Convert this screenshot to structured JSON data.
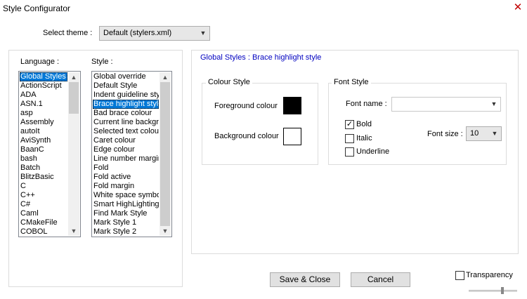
{
  "window": {
    "title": "Style Configurator",
    "close_glyph": "✕"
  },
  "theme": {
    "label": "Select theme :",
    "value": "Default (stylers.xml)"
  },
  "language": {
    "label": "Language :",
    "items": [
      "Global Styles",
      "ActionScript",
      "ADA",
      "ASN.1",
      "asp",
      "Assembly",
      "autoIt",
      "AviSynth",
      "BaanC",
      "bash",
      "Batch",
      "BlitzBasic",
      "C",
      "C++",
      "C#",
      "Caml",
      "CMakeFile",
      "COBOL"
    ],
    "selected_index": 0
  },
  "style": {
    "label": "Style :",
    "items": [
      "Global override",
      "Default Style",
      "Indent guideline style",
      "Brace highlight style",
      "Bad brace colour",
      "Current line background colour",
      "Selected text colour",
      "Caret colour",
      "Edge colour",
      "Line number margin",
      "Fold",
      "Fold active",
      "Fold margin",
      "White space symbol",
      "Smart HighLighting",
      "Find Mark Style",
      "Mark Style 1",
      "Mark Style 2"
    ],
    "selected_index": 3
  },
  "detail": {
    "heading": "Global Styles : Brace highlight style"
  },
  "colour_style": {
    "title": "Colour Style",
    "foreground_label": "Foreground colour",
    "background_label": "Background colour",
    "foreground_color": "#000000",
    "background_color": "#ffffff"
  },
  "font_style": {
    "title": "Font Style",
    "font_name_label": "Font name :",
    "font_name_value": "",
    "bold_label": "Bold",
    "italic_label": "Italic",
    "underline_label": "Underline",
    "bold_checked": true,
    "italic_checked": false,
    "underline_checked": false,
    "font_size_label": "Font size :",
    "font_size_value": "10",
    "check_glyph": "✓"
  },
  "buttons": {
    "save_close": "Save & Close",
    "cancel": "Cancel"
  },
  "transparency": {
    "label": "Transparency",
    "checked": false
  },
  "icons": {
    "dropdown": "chevron-down-icon",
    "scroll_up": "chevron-up-icon",
    "scroll_down": "chevron-down-icon"
  },
  "colors": {
    "selection": "#0078d7",
    "heading": "#0000c0"
  }
}
